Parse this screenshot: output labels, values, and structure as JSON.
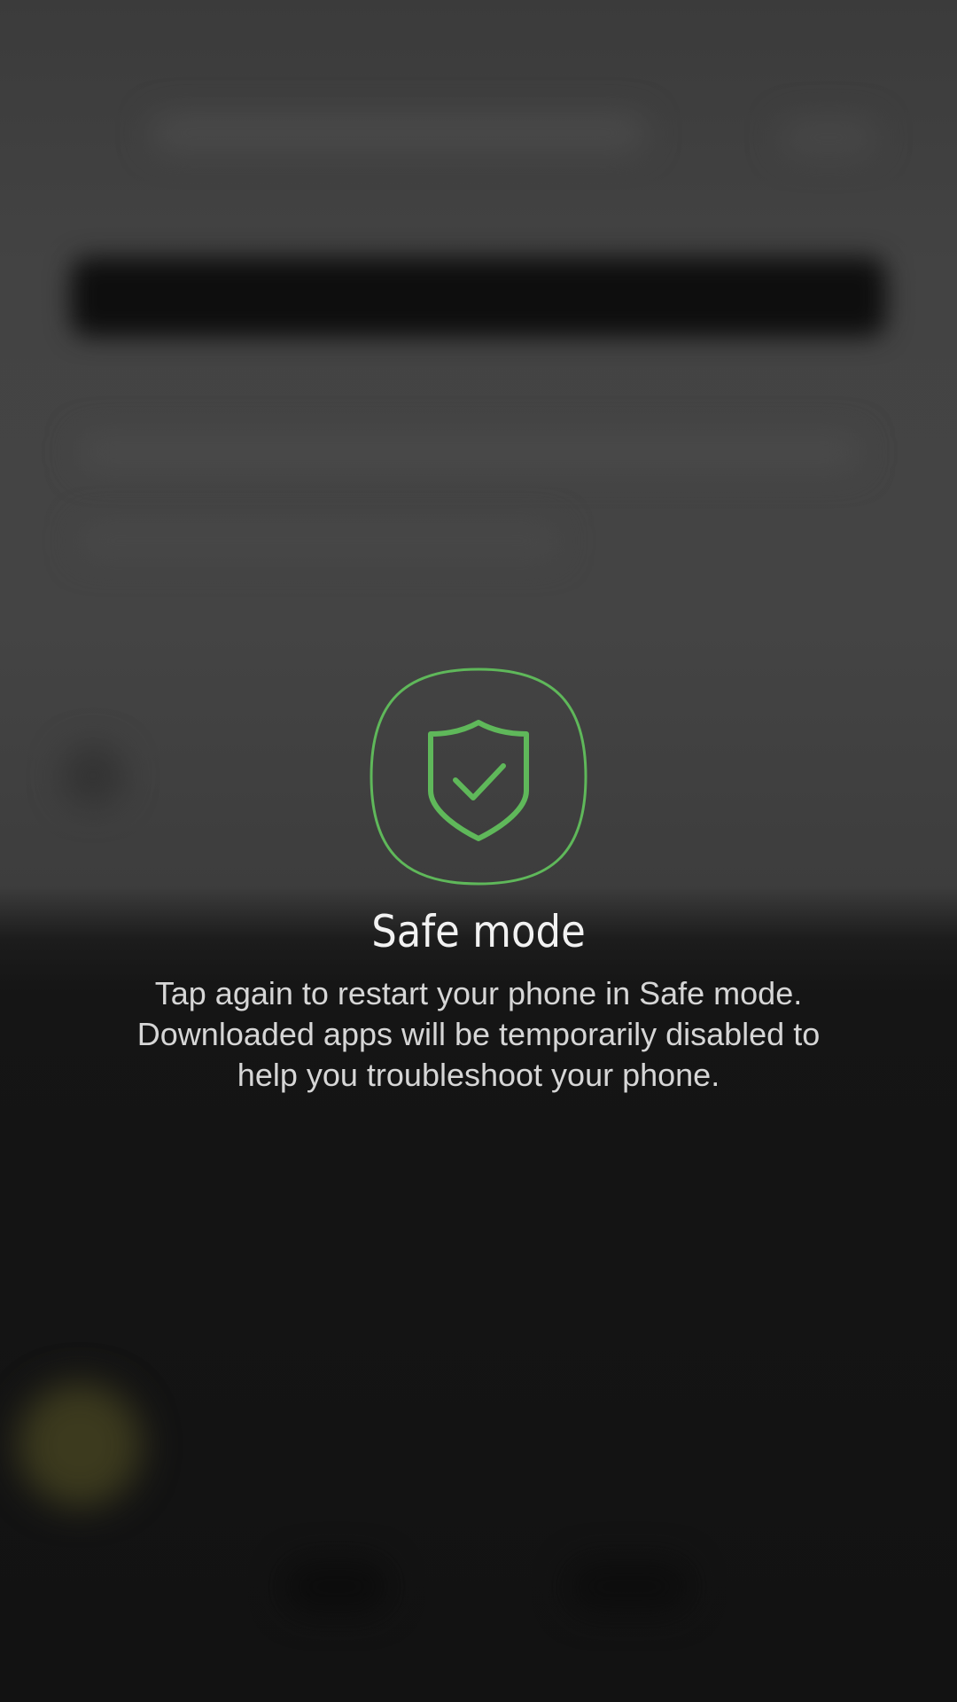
{
  "safe_mode": {
    "icon": "shield-check-icon",
    "accent_color": "#5fb85a",
    "title": "Safe mode",
    "description_lines": [
      "Tap again to restart your phone in Safe mode.",
      "Downloaded apps will be temporarily disabled to",
      "help you troubleshoot your phone."
    ]
  }
}
